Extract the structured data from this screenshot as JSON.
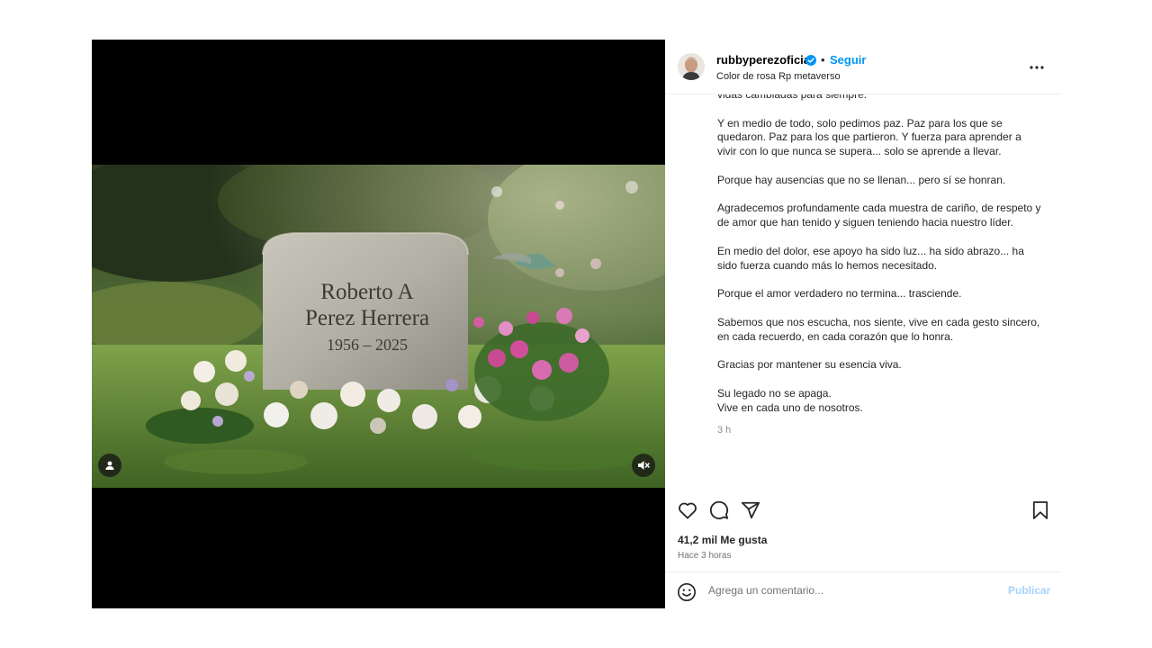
{
  "post": {
    "epitaph": {
      "line1": "Roberto A",
      "line2": "Perez Herrera",
      "years": "1956 – 2025"
    }
  },
  "header": {
    "username": "rubbyperezoficial",
    "dot": "•",
    "follow_label": "Seguir",
    "audio": "Color de rosa Rp metaverso"
  },
  "caption": {
    "paragraphs": [
      "vidas cambiadas para siempre.",
      "Y en medio de todo, solo pedimos paz. Paz para los que se quedaron. Paz para los que partieron. Y fuerza para aprender a vivir con lo que nunca se supera... solo se aprende a llevar.",
      "Porque hay ausencias que no se llenan... pero sí se honran.",
      "Agradecemos profundamente cada muestra de cariño, de respeto y de amor que han tenido y siguen teniendo hacia nuestro líder.",
      "En medio del dolor, ese apoyo ha sido luz... ha sido abrazo... ha sido fuerza cuando más lo hemos necesitado.",
      "Porque el amor verdadero no termina... trasciende.",
      "Sabemos que nos escucha, nos siente, vive en cada gesto sincero, en cada recuerdo, en cada corazón que lo honra.",
      "Gracias por mantener su esencia viva."
    ],
    "closing_1": "Su legado no se apaga.",
    "closing_2": "Vive en cada uno de nosotros.",
    "time": "3 h"
  },
  "stats": {
    "likes": "41,2 mil Me gusta",
    "ago": "Hace 3 horas"
  },
  "comment": {
    "placeholder": "Agrega un comentario...",
    "publish_label": "Publicar"
  },
  "colors": {
    "accent": "#0095f6",
    "publish_disabled": "#a5d3fb",
    "verified": "#0095f6"
  },
  "icons": {
    "like": "heart-icon",
    "comment": "comment-bubble-icon",
    "share": "paper-plane-icon",
    "save": "bookmark-icon",
    "more": "more-options-icon",
    "emoji": "emoji-icon",
    "tagged": "user-tag-icon",
    "audio": "muted-speaker-icon"
  }
}
